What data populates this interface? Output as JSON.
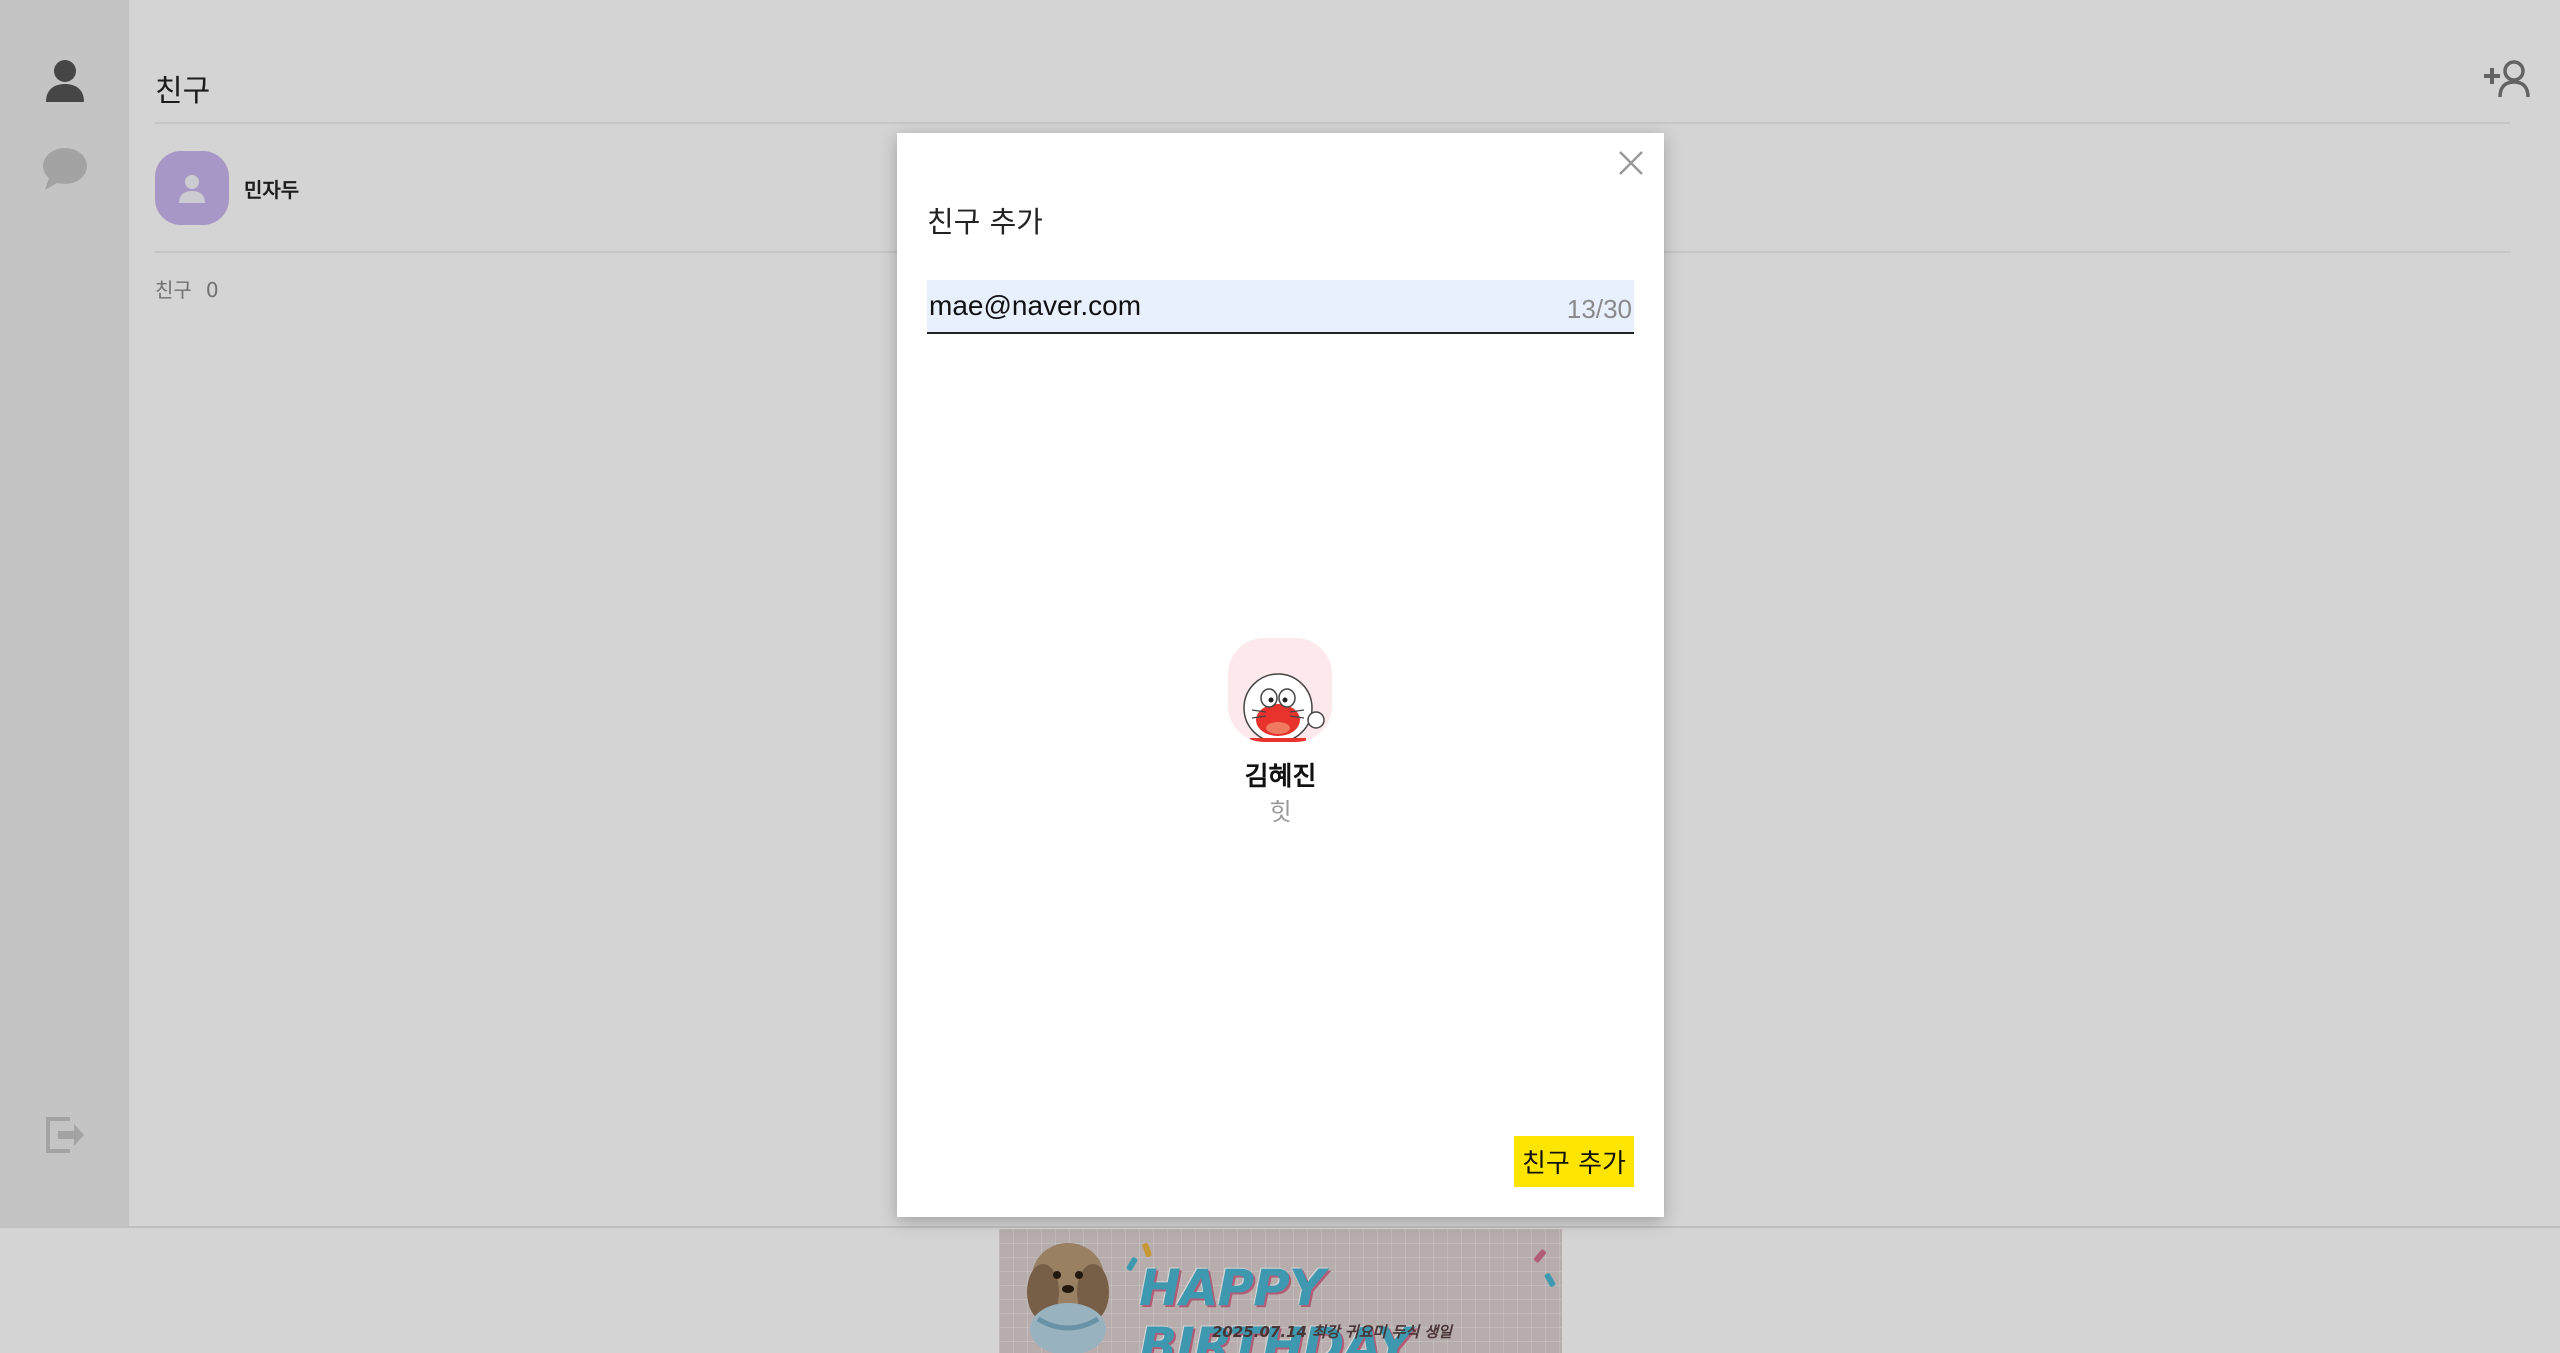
{
  "main": {
    "title": "친구",
    "my_profile": {
      "name": "민자두"
    },
    "friend_count_label": "친구",
    "friend_count_value": "0"
  },
  "banner": {
    "title": "HAPPY BIRTHDAY",
    "subtitle": "2025.07.14 최강 귀요미 두식 생일"
  },
  "modal": {
    "title": "친구 추가",
    "search": {
      "value": "mae@naver.com",
      "counter": "13/30"
    },
    "result": {
      "name": "김혜진",
      "status": "힛"
    },
    "confirm_label": "친구 추가"
  },
  "icons": {
    "sidebar_friends": "person-icon",
    "sidebar_chats": "chat-bubble-icon",
    "sidebar_logout": "logout-icon",
    "add_friend": "add-person-icon",
    "close": "close-icon"
  },
  "colors": {
    "accent": "#fee500",
    "search_bg": "#e9f0fd",
    "my_avatar": "#c8b6ee"
  }
}
